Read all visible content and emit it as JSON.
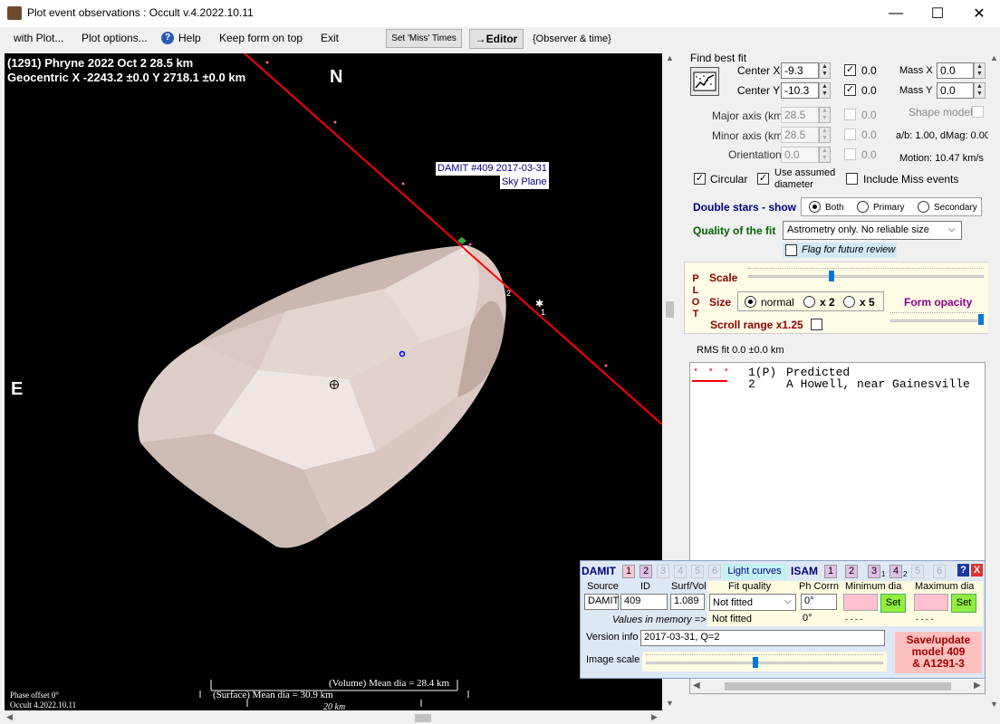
{
  "window": {
    "title": "Plot event observations : Occult v.4.2022.10.11",
    "minimize": "—",
    "maximize": "☐",
    "close": "✕"
  },
  "menu": {
    "with_plot": "with Plot...",
    "plot_options": "Plot options...",
    "help": "Help",
    "keep_on_top": "Keep form on top",
    "exit": "Exit",
    "set_miss_times": "Set 'Miss' Times",
    "editor": "→Editor",
    "observer_time": "{Observer & time}"
  },
  "plot": {
    "title_line1": "(1291) Phryne  2022 Oct 2   28.5 km",
    "title_line2": "Geocentric  X  -2243.2 ±0.0  Y 2718.1 ±0.0 km",
    "north": "N",
    "east": "E",
    "model_label_line1": "DAMIT #409 2017-03-31",
    "model_label_line2": "Sky Plane",
    "phase_offset": "Phase offset 0°",
    "version": "Occult 4.2022.10.11",
    "volume_dia": "(Volume) Mean dia = 28.4 km",
    "surface_dia": "(Surface) Mean dia = 30.9 km",
    "scale_bar": "20 km",
    "chord_label_1": "1",
    "chord_label_2": "2"
  },
  "fit": {
    "find_best_fit": "Find best fit",
    "center_x_label": "Center X",
    "center_x": "-9.3",
    "center_y_label": "Center Y",
    "center_y": "-10.3",
    "center_x_uncert": "0.0",
    "center_y_uncert": "0.0",
    "mass_x_label": "Mass X",
    "mass_x": "0.0",
    "mass_y_label": "Mass Y",
    "mass_y": "0.0",
    "major_axis_label": "Major axis (km)",
    "major_axis": "28.5",
    "major_uncert": "0.0",
    "minor_axis_label": "Minor axis (km)",
    "minor_axis": "28.5",
    "minor_uncert": "0.0",
    "orientation_label": "Orientation",
    "orientation": "0.0",
    "orientation_uncert": "0.0",
    "shape_model": "Shape model",
    "ab_dmag": "a/b: 1.00, dMag: 0.00",
    "motion": "Motion: 10.47 km/s",
    "circular": "Circular",
    "use_assumed_line1": "Use assumed",
    "use_assumed_line2": "diameter",
    "include_miss": "Include Miss events",
    "double_stars": "Double stars - show",
    "ds_both": "Both",
    "ds_primary": "Primary",
    "ds_secondary": "Secondary",
    "quality_label": "Quality of the fit",
    "quality_value": "Astrometry only. No reliable size",
    "flag_review": "Flag for future review"
  },
  "plot_opts": {
    "vertical_label": [
      "P",
      "L",
      "O",
      "T"
    ],
    "scale": "Scale",
    "size": "Size",
    "normal": "normal",
    "x2": "x 2",
    "x5": "x 5",
    "form_opacity": "Form opacity",
    "scroll_range": "Scroll range x1.25",
    "scale_level": 0.35,
    "opacity_level": 1.0
  },
  "rms": "RMS fit 0.0 ±0.0 km",
  "legend": [
    {
      "code": "1(P)",
      "name": "Predicted"
    },
    {
      "code": "2",
      "name": "A Howell, near Gainesville"
    }
  ],
  "damit": {
    "damit_title": "DAMIT",
    "damit_nums": [
      "1",
      "2",
      "3",
      "4",
      "5",
      "6"
    ],
    "light_curves": "Light curves",
    "isam_title": "ISAM",
    "isam_nums": [
      "1",
      "2",
      "3",
      "4",
      "5",
      "6"
    ],
    "isam_sub": [
      "1",
      "2"
    ],
    "help": "?",
    "close": "X",
    "source_hdr": "Source",
    "id_hdr": "ID",
    "surfvol_hdr": "Surf/Vol",
    "fitq_hdr": "Fit quality",
    "phcorr_hdr": "Ph Corrn",
    "mindia_hdr": "Minimum dia",
    "maxdia_hdr": "Maximum dia",
    "source": "DAMIT",
    "id": "409",
    "surfvol": "1.089",
    "fit_quality": "Not fitted",
    "ph_corr": "0°",
    "set": "Set",
    "values_in_memory": "Values in memory =>",
    "mem_fit": "Not fitted",
    "mem_ph": "0°",
    "mem_min": "- - - -",
    "mem_max": "- - - -",
    "version_label": "Version info",
    "version_value": "2017-03-31, Q=2",
    "image_scale": "Image scale",
    "save_line1": "Save/update",
    "save_line2": "model 409",
    "save_line3": "& A1291-3"
  }
}
